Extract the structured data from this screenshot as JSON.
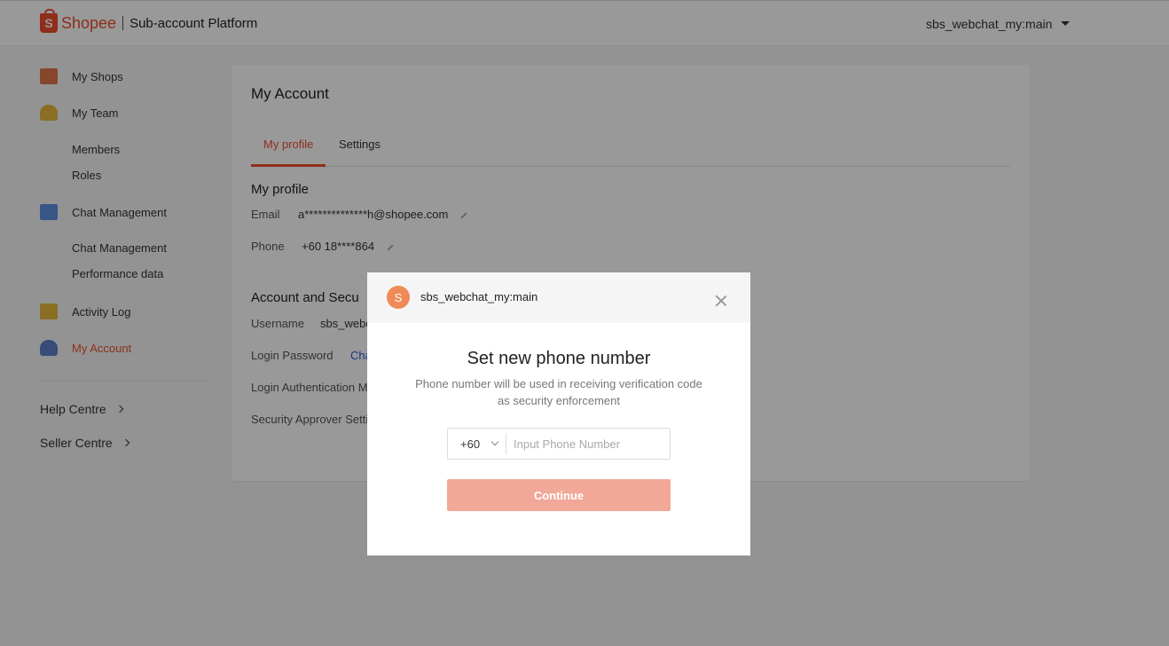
{
  "header": {
    "logo_text": "Shopee",
    "logo_glyph": "S",
    "platform_title": "Sub-account Platform",
    "account_name": "sbs_webchat_my:main"
  },
  "sidebar": {
    "items": [
      {
        "label": "My Shops",
        "icon": "shop-icon"
      },
      {
        "label": "My Team",
        "icon": "team-icon"
      },
      {
        "label": "Members"
      },
      {
        "label": "Roles"
      },
      {
        "label": "Chat Management",
        "icon": "chat-icon"
      },
      {
        "label": "Chat Management"
      },
      {
        "label": "Performance data"
      },
      {
        "label": "Activity Log",
        "icon": "log-icon"
      },
      {
        "label": "My Account",
        "icon": "account-icon",
        "active": true
      }
    ],
    "links": [
      {
        "label": "Help Centre"
      },
      {
        "label": "Seller Centre"
      }
    ]
  },
  "main": {
    "title": "My Account",
    "tabs": [
      {
        "label": "My profile",
        "active": true
      },
      {
        "label": "Settings"
      }
    ],
    "profile": {
      "title": "My profile",
      "email_label": "Email",
      "email_value": "a**************h@shopee.com",
      "phone_label": "Phone",
      "phone_value": "+60 18****864"
    },
    "security": {
      "title": "Account and Secu",
      "username_label": "Username",
      "username_value": "sbs_webc",
      "password_label": "Login Password",
      "password_link": "Cha",
      "auth_label": "Login Authentication Me",
      "approver_label": "Security Approver Settin"
    }
  },
  "modal": {
    "avatar_letter": "S",
    "username": "sbs_webchat_my:main",
    "title": "Set new phone number",
    "description": "Phone number will be used in receiving verification code as security enforcement",
    "country_code": "+60",
    "phone_placeholder": "Input Phone Number",
    "continue_label": "Continue"
  },
  "colors": {
    "brand": "#ee4d2d",
    "button_disabled": "#f2a898",
    "avatar": "#f08a56"
  }
}
